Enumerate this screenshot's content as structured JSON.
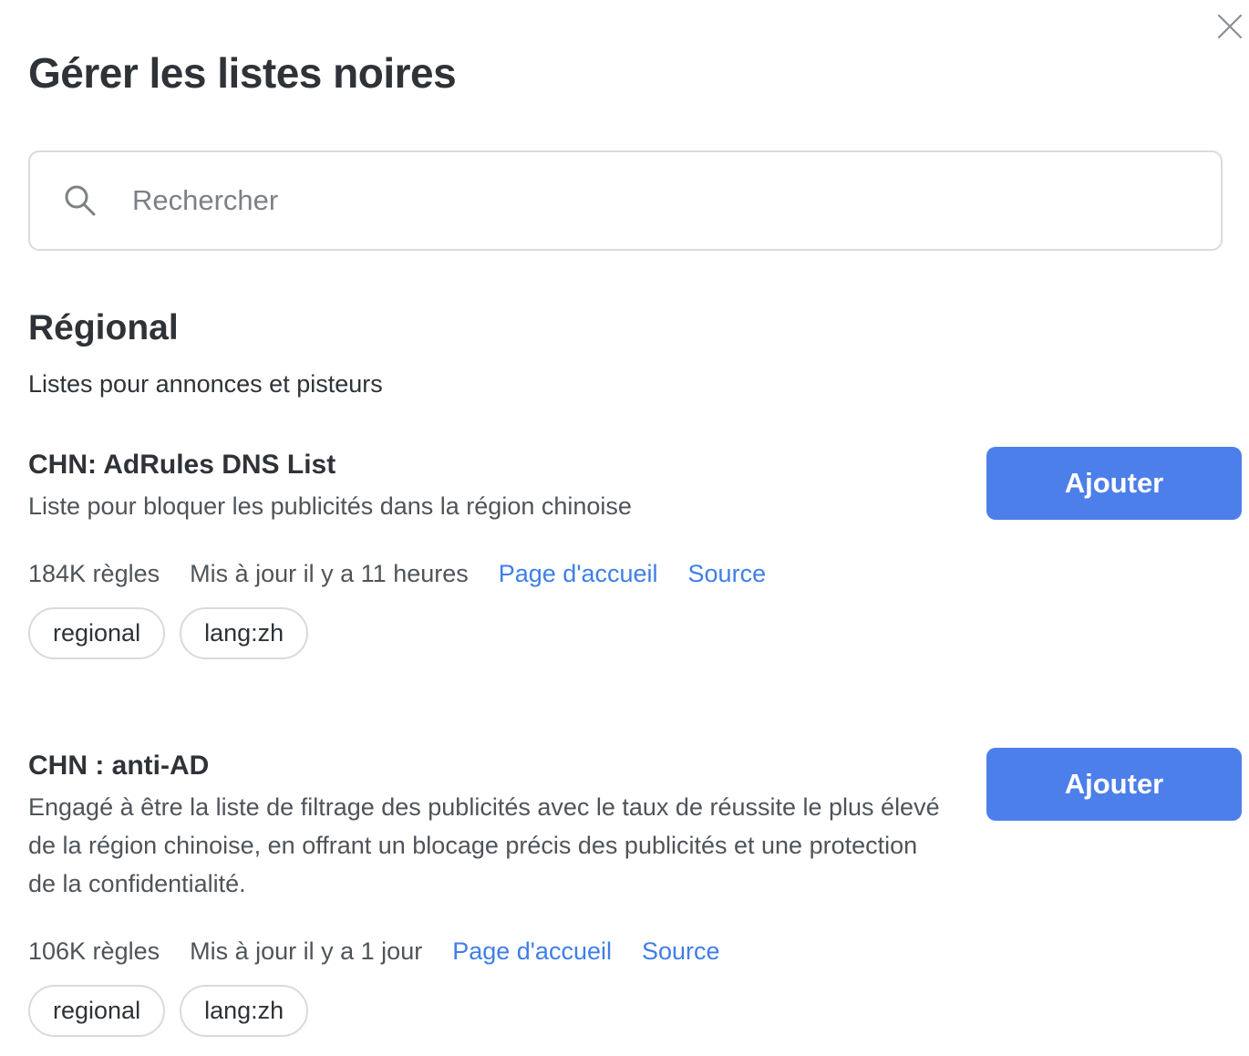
{
  "dialog": {
    "title": "Gérer les listes noires",
    "close_icon": "close-icon"
  },
  "search": {
    "placeholder": "Rechercher",
    "value": "",
    "icon": "search-icon"
  },
  "section": {
    "title": "Régional",
    "subtitle": "Listes pour annonces et pisteurs"
  },
  "lists": [
    {
      "name": "CHN: AdRules DNS List",
      "description": "Liste pour bloquer les publicités dans la région chinoise",
      "rules": "184K règles",
      "updated": "Mis à jour il y a 11 heures",
      "homepage_label": "Page d'accueil",
      "source_label": "Source",
      "tags": [
        "regional",
        "lang:zh"
      ],
      "button_label": "Ajouter"
    },
    {
      "name": "CHN : anti-AD",
      "description": "Engagé à être la liste de filtrage des publicités avec le taux de réussite le plus élevé de la région chinoise, en offrant un blocage précis des publicités et une protection de la confidentialité.",
      "rules": "106K règles",
      "updated": "Mis à jour il y a 1 jour",
      "homepage_label": "Page d'accueil",
      "source_label": "Source",
      "tags": [
        "regional",
        "lang:zh"
      ],
      "button_label": "Ajouter"
    }
  ],
  "colors": {
    "accent": "#4d7fea",
    "link": "#3f7ee8",
    "border": "#d9dadb",
    "text": "#2d3338"
  }
}
